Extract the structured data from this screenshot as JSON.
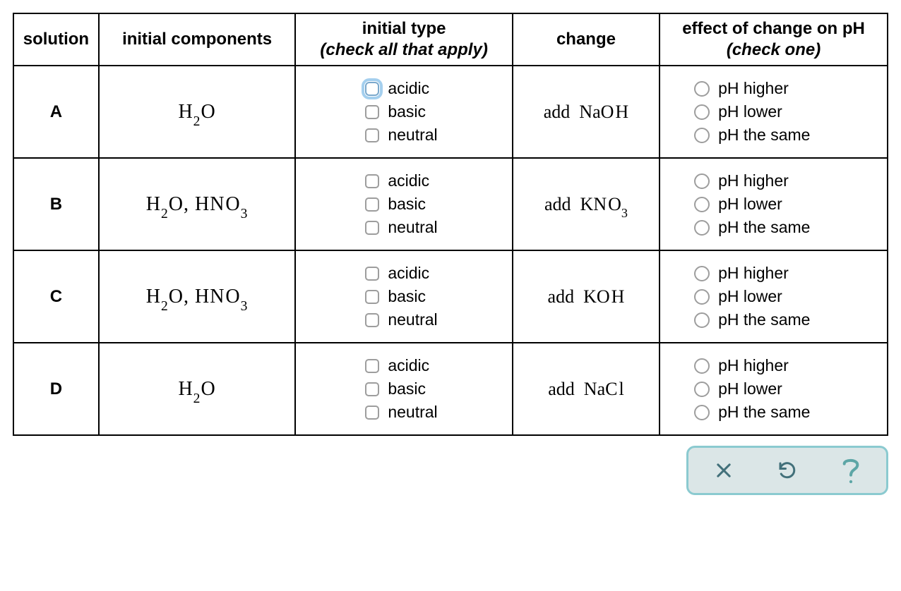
{
  "headers": {
    "solution": "solution",
    "components": "initial components",
    "type_main": "initial type",
    "type_sub": "(check all that apply)",
    "change": "change",
    "effect_main": "effect of change on pH",
    "effect_sub": "(check one)"
  },
  "type_options": [
    "acidic",
    "basic",
    "neutral"
  ],
  "effect_options": [
    "pH higher",
    "pH lower",
    "pH the same"
  ],
  "rows": [
    {
      "letter": "A",
      "components_html": "H<sub>2</sub>O",
      "change_prefix": "add",
      "change_html": "Na<span class='chem-space'>O</span>H",
      "focus_first_cb": true
    },
    {
      "letter": "B",
      "components_html": "H<sub>2</sub>O, H<span class='chem-space'>N</span>O<sub>3</sub>",
      "change_prefix": "add",
      "change_html": "K<span class='chem-space'>N</span>O<sub>3</sub>",
      "focus_first_cb": false
    },
    {
      "letter": "C",
      "components_html": "H<sub>2</sub>O, H<span class='chem-space'>N</span>O<sub>3</sub>",
      "change_prefix": "add",
      "change_html": "K<span class='chem-space'>O</span>H",
      "focus_first_cb": false
    },
    {
      "letter": "D",
      "components_html": "H<sub>2</sub>O",
      "change_prefix": "add",
      "change_html": "Na<span class='chem-space'>C</span>l",
      "focus_first_cb": false
    }
  ],
  "toolbar": {
    "clear": "clear",
    "reset": "reset",
    "help": "help",
    "colors": {
      "icon": "#42707a",
      "help": "#5da6a6"
    }
  }
}
